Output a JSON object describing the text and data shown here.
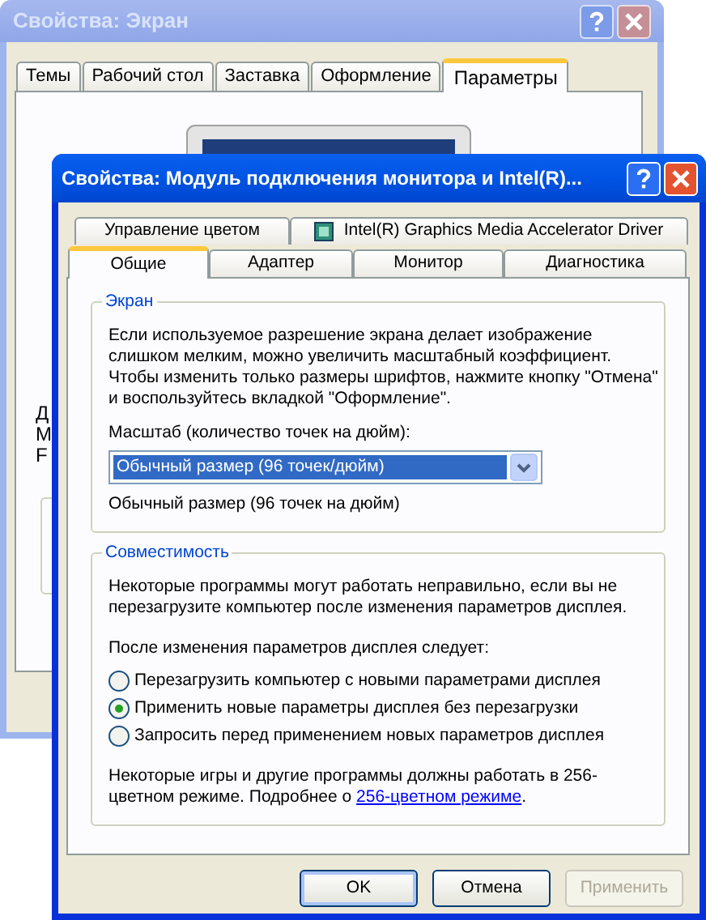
{
  "back_window": {
    "title": "Свойства: Экран",
    "tabs": [
      {
        "label": "Темы",
        "selected": false
      },
      {
        "label": "Рабочий стол",
        "selected": false
      },
      {
        "label": "Заставка",
        "selected": false
      },
      {
        "label": "Оформление",
        "selected": false
      },
      {
        "label": "Параметры",
        "selected": true
      }
    ],
    "partial_texts": [
      "Д",
      "М",
      "F"
    ]
  },
  "front_window": {
    "title": "Свойства: Модуль подключения монитора и Intel(R)...",
    "tab_rows": [
      [
        {
          "label": "Управление цветом",
          "selected": false,
          "has_icon": false
        },
        {
          "label": "Intel(R) Graphics Media Accelerator Driver",
          "selected": false,
          "has_icon": true
        }
      ],
      [
        {
          "label": "Общие",
          "selected": true,
          "has_icon": false
        },
        {
          "label": "Адаптер",
          "selected": false,
          "has_icon": false
        },
        {
          "label": "Монитор",
          "selected": false,
          "has_icon": false
        },
        {
          "label": "Диагностика",
          "selected": false,
          "has_icon": false
        }
      ]
    ],
    "screen_group": {
      "title": "Экран",
      "description": "Если используемое разрешение экрана делает изображение слишком мелким, можно увеличить масштабный коэффициент. Чтобы изменить только размеры шрифтов, нажмите кнопку \"Отмена\" и воспользуйтесь вкладкой \"Оформление\".",
      "scale_label": "Масштаб (количество точек на дюйм):",
      "scale_value": "Обычный размер (96 точек/дюйм)",
      "scale_note": "Обычный размер (96 точек на дюйм)"
    },
    "compat_group": {
      "title": "Совместимость",
      "warning": "Некоторые программы могут работать неправильно, если вы не перезагрузите компьютер после изменения параметров дисплея.",
      "after_label": "После изменения параметров дисплея следует:",
      "options": [
        {
          "label": "Перезагрузить компьютер с новыми параметрами дисплея",
          "selected": false
        },
        {
          "label": "Применить новые параметры дисплея без перезагрузки",
          "selected": true
        },
        {
          "label": "Запросить перед применением новых параметров дисплея",
          "selected": false
        }
      ],
      "note": "Некоторые игры и другие программы должны работать в 256-цветном режиме. Подробнее о ",
      "link": "256-цветном режиме",
      "note_end": "."
    },
    "buttons": [
      {
        "label": "OK",
        "disabled": false,
        "default": true
      },
      {
        "label": "Отмена",
        "disabled": false,
        "default": false
      },
      {
        "label": "Применить",
        "disabled": true,
        "default": false
      }
    ]
  }
}
